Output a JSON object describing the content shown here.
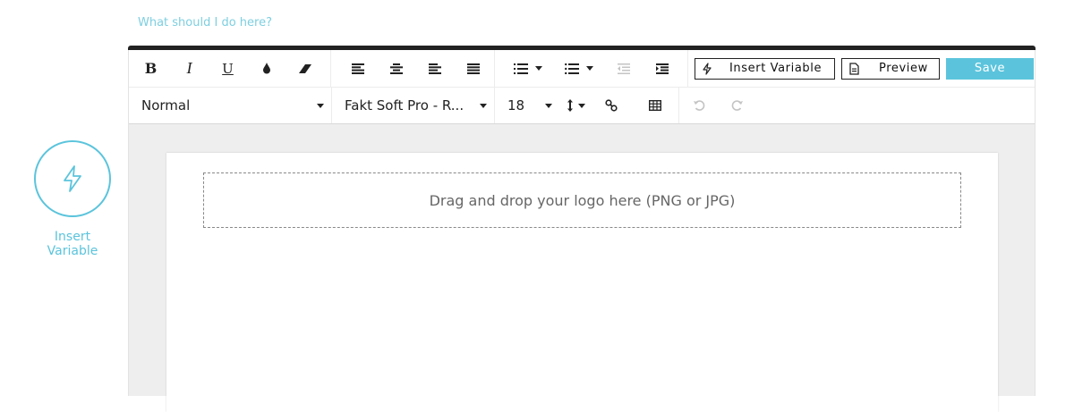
{
  "help_link": "What should I do here?",
  "side_insert": {
    "line1": "Insert",
    "line2": "Variable",
    "icon": "lightning-icon",
    "color": "#5bc4dc"
  },
  "toolbar": {
    "bold": "B",
    "italic": "I",
    "underline": "U",
    "insert_variable": "Insert Variable",
    "preview": "Preview",
    "save": "Save",
    "style_select": "Normal",
    "font_select": "Fakt Soft Pro - R...",
    "size_select": "18"
  },
  "canvas": {
    "dropzone_text": "Drag and drop your logo here (PNG or JPG)"
  },
  "colors": {
    "accent": "#5bc4dc",
    "topbar": "#222222",
    "canvas_bg": "#eeeeee"
  }
}
